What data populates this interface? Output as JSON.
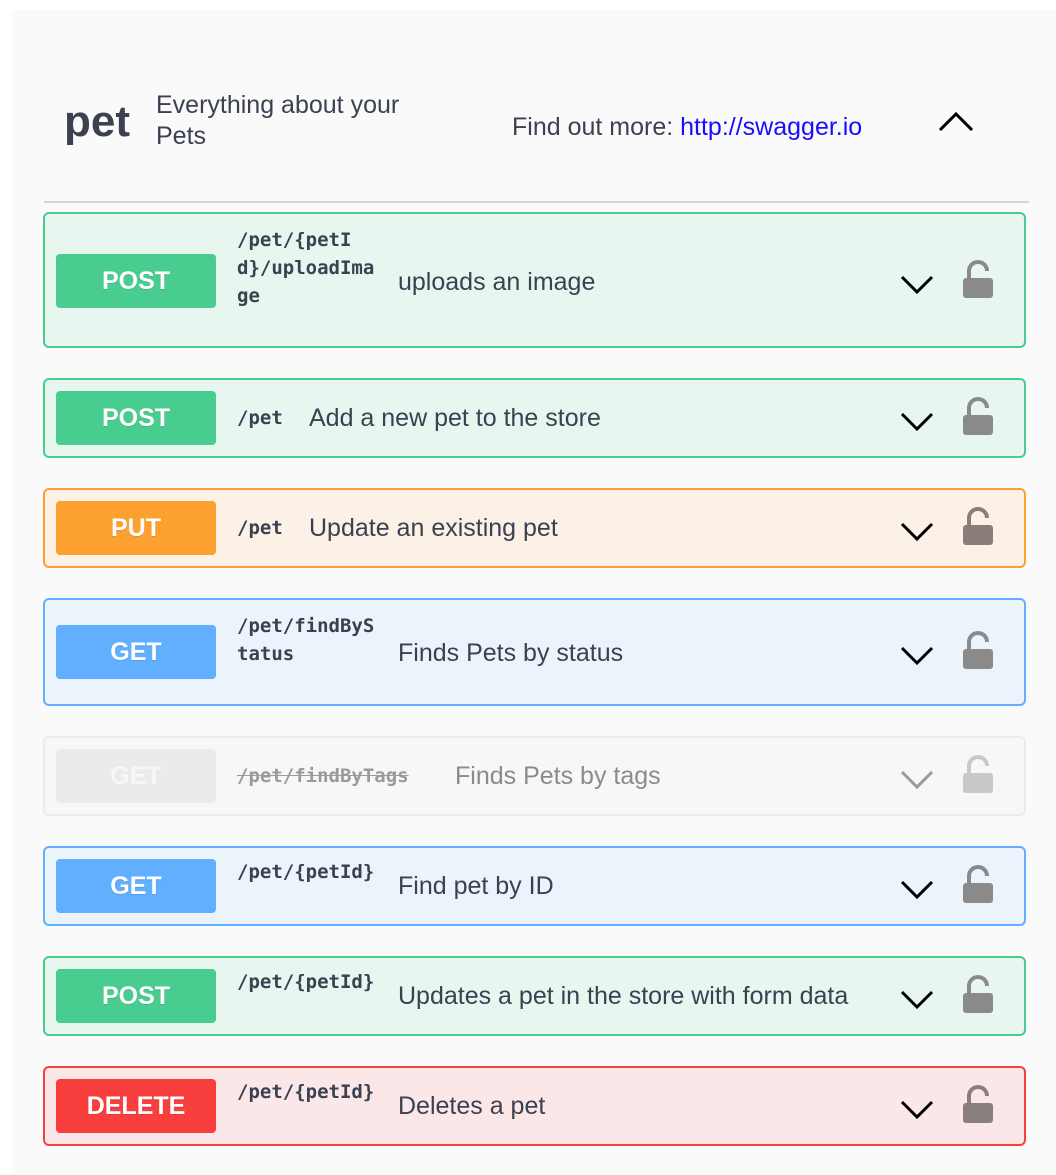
{
  "tag": {
    "name": "pet",
    "description": "Everything about your Pets",
    "more_label": "Find out more:",
    "more_link": "http://swagger.io",
    "toggle_icon": "chevron-up-icon"
  },
  "colors": {
    "post": "#49cc90",
    "put": "#fca130",
    "get": "#61affe",
    "delete": "#f93e3e",
    "deprecated": "#ebebeb",
    "link": "#1a0dff"
  },
  "operations": [
    {
      "method": "POST",
      "path": "/pet/{petId}/uploadImage",
      "summary": "uploads an image",
      "deprecated": false
    },
    {
      "method": "POST",
      "path": "/pet",
      "summary": "Add a new pet to the store",
      "deprecated": false
    },
    {
      "method": "PUT",
      "path": "/pet",
      "summary": "Update an existing pet",
      "deprecated": false
    },
    {
      "method": "GET",
      "path": "/pet/findByStatus",
      "summary": "Finds Pets by status",
      "deprecated": false
    },
    {
      "method": "GET",
      "path": "/pet/findByTags",
      "summary": "Finds Pets by tags",
      "deprecated": true
    },
    {
      "method": "GET",
      "path": "/pet/{petId}",
      "summary": "Find pet by ID",
      "deprecated": false
    },
    {
      "method": "POST",
      "path": "/pet/{petId}",
      "summary": "Updates a pet in the store with form data",
      "deprecated": false
    },
    {
      "method": "DELETE",
      "path": "/pet/{petId}",
      "summary": "Deletes a pet",
      "deprecated": false
    }
  ]
}
